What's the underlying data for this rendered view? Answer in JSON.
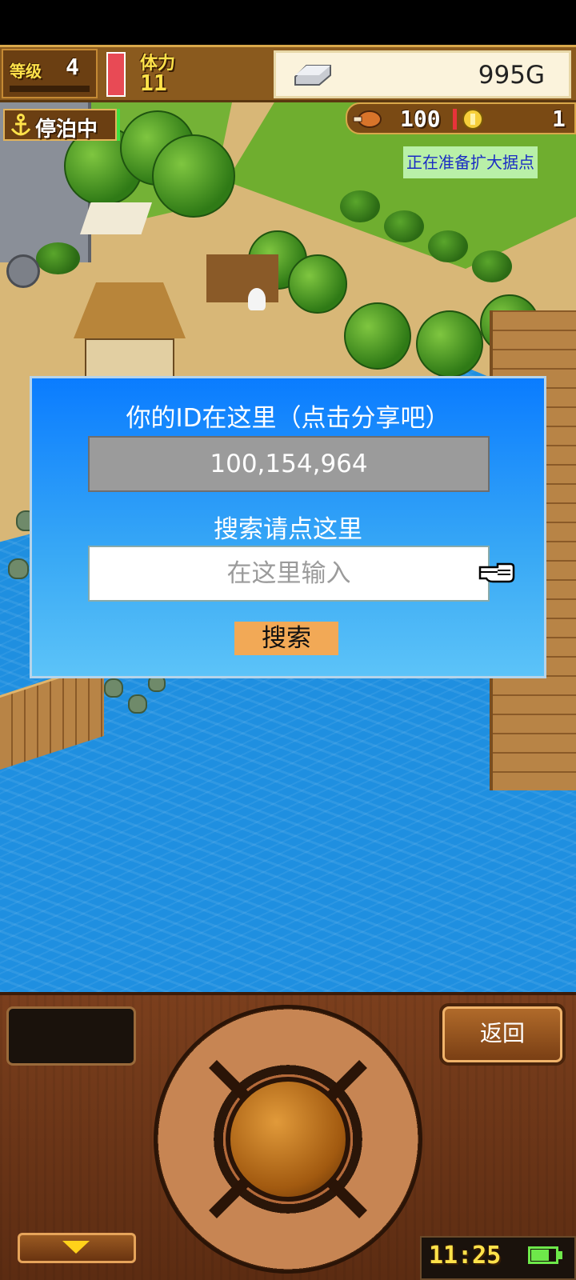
{
  "hud": {
    "level_label": "等级",
    "level_value": "4",
    "stamina_label": "体力",
    "stamina_value": "11",
    "gold": "995G",
    "docked_label": "停泊中",
    "food_value": "100",
    "coin_value": "1"
  },
  "map": {
    "expand_status": "正在准备扩大据点"
  },
  "dialog": {
    "title": "你的ID在这里（点击分享吧）",
    "id_value": "100,154,964",
    "search_label": "搜索请点这里",
    "search_placeholder": "在这里输入",
    "search_button": "搜索"
  },
  "controls": {
    "back_label": "返回",
    "clock": "11:25"
  },
  "colors": {
    "dialog_top": "#0a7cff",
    "dialog_bottom": "#5cc3f8",
    "search_button_bg": "#f2a956",
    "hud_text": "#ffe24a"
  },
  "icons": [
    "anchor-icon",
    "silver-ingot-icon",
    "meat-icon",
    "coin-icon",
    "pointing-hand-icon",
    "down-arrow-icon",
    "battery-icon"
  ]
}
